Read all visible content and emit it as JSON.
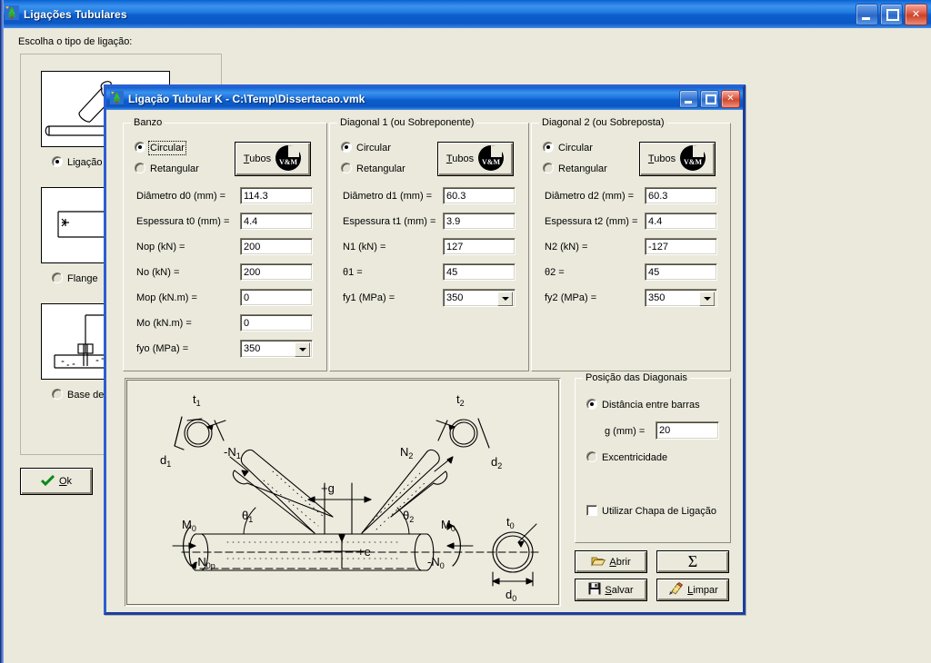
{
  "outer_window": {
    "title": "Ligações Tubulares",
    "icon": "app-tree-icon",
    "minimize": "–",
    "maximize": "□",
    "close": "✕"
  },
  "main": {
    "choose_label": "Escolha o tipo de ligação:",
    "types": [
      {
        "label": "Ligação",
        "selected": true,
        "thumb": "k-joint-thumb"
      },
      {
        "label": "Flange",
        "selected": false,
        "thumb": "flange-thumb"
      },
      {
        "label": "Base de",
        "selected": false,
        "thumb": "base-plate-thumb"
      }
    ],
    "ok_button": "Ok",
    "ok_icon": "check-icon"
  },
  "dialog": {
    "title": "Ligação Tubular K - C:\\Temp\\Dissertacao.vmk",
    "icon": "app-tree-icon",
    "minimize": "–",
    "maximize": "□",
    "close": "✕",
    "banzo": {
      "title": "Banzo",
      "shape_circular": "Circular",
      "shape_rectangular": "Retangular",
      "shape_selected": "Circular",
      "tubos_button": "Tubos",
      "tubos_logo": "vm-logo-icon",
      "fields": [
        {
          "label": "Diâmetro d0 (mm) =",
          "value": "114.3",
          "type": "text"
        },
        {
          "label": "Espessura t0 (mm) =",
          "value": "4.4",
          "type": "text"
        },
        {
          "label": "Nop (kN) =",
          "value": "200",
          "type": "text"
        },
        {
          "label": "No (kN) =",
          "value": "200",
          "type": "text"
        },
        {
          "label": "Mop (kN.m) =",
          "value": "0",
          "type": "text"
        },
        {
          "label": "Mo (kN.m) =",
          "value": "0",
          "type": "text"
        },
        {
          "label": "fyo (MPa) =",
          "value": "350",
          "type": "combo"
        }
      ]
    },
    "diagonal1": {
      "title": "Diagonal 1 (ou Sobreponente)",
      "shape_circular": "Circular",
      "shape_rectangular": "Retangular",
      "shape_selected": "Circular",
      "tubos_button": "Tubos",
      "tubos_logo": "vm-logo-icon",
      "fields": [
        {
          "label": "Diâmetro d1 (mm) =",
          "value": "60.3",
          "type": "text"
        },
        {
          "label": "Espessura t1 (mm) =",
          "value": "3.9",
          "type": "text"
        },
        {
          "label": "N1 (kN) =",
          "value": "127",
          "type": "text"
        },
        {
          "label": "θ1 =",
          "value": "45",
          "type": "text"
        },
        {
          "label": "fy1 (MPa) =",
          "value": "350",
          "type": "combo"
        }
      ]
    },
    "diagonal2": {
      "title": "Diagonal 2 (ou Sobreposta)",
      "shape_circular": "Circular",
      "shape_rectangular": "Retangular",
      "shape_selected": "Circular",
      "tubos_button": "Tubos",
      "tubos_logo": "vm-logo-icon",
      "fields": [
        {
          "label": "Diâmetro d2 (mm) =",
          "value": "60.3",
          "type": "text"
        },
        {
          "label": "Espessura t2 (mm) =",
          "value": "4.4",
          "type": "text"
        },
        {
          "label": "N2 (kN) =",
          "value": "-127",
          "type": "text"
        },
        {
          "label": "θ2 =",
          "value": "45",
          "type": "text"
        },
        {
          "label": "fy2 (MPa) =",
          "value": "350",
          "type": "combo"
        }
      ]
    },
    "posicao": {
      "title": "Posição das Diagonais",
      "opt_distancia": "Distância entre barras",
      "opt_excentricidade": "Excentricidade",
      "selected": "Distância entre barras",
      "g_label": "g (mm) =",
      "g_value": "20",
      "checkbox_label": "Utilizar Chapa de Ligação",
      "checkbox_checked": false
    },
    "actions": [
      {
        "label": "Abrir",
        "icon": "open-folder-icon"
      },
      {
        "label": "Σ",
        "icon": "sigma-icon"
      },
      {
        "label": "Salvar",
        "icon": "floppy-disk-icon"
      },
      {
        "label": "Limpar",
        "icon": "eraser-icon"
      }
    ],
    "diagram": {
      "name": "k-joint-technical-drawing",
      "labels": {
        "t1": "t₁",
        "t2": "t₂",
        "t0": "t₀",
        "d1": "d₁",
        "d2": "d₂",
        "d0": "d₀",
        "n1": "-N₁",
        "n2": "N₂",
        "theta1": "θ₁",
        "theta2": "θ₂",
        "g": "+g",
        "e": "+e",
        "m0_left": "M₀",
        "m0_right": "M₀",
        "nop": "-N₀ₚ",
        "n0": "-N₀"
      }
    }
  },
  "colors": {
    "face": "#EAE9DC",
    "titlebar_blue": "#0B57C4",
    "dialog_border": "#2C5FD0",
    "field_bg": "#FFFFFF",
    "diagram_bg": "#EDEBDE"
  }
}
